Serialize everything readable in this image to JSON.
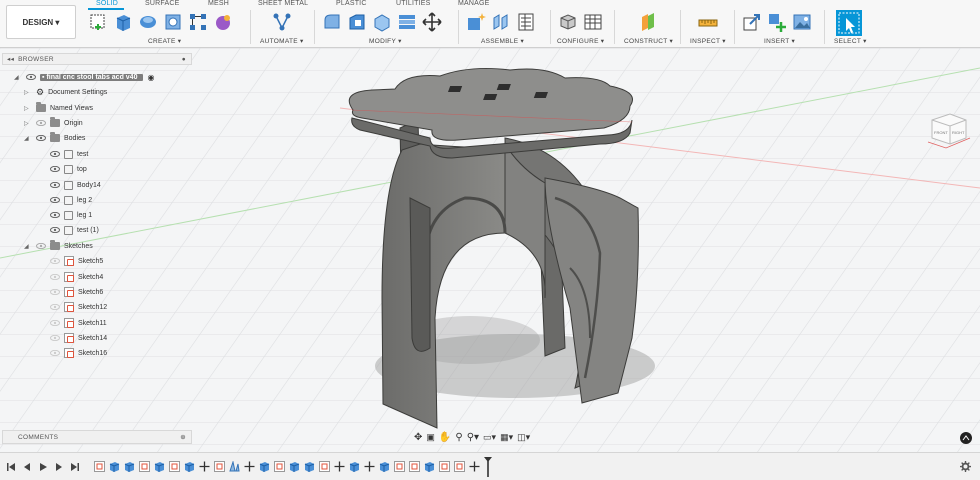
{
  "design_label": "DESIGN ▾",
  "tabs": [
    "SOLID",
    "SURFACE",
    "MESH",
    "SHEET METAL",
    "PLASTIC",
    "UTILITIES",
    "MANAGE"
  ],
  "groups": {
    "create": "CREATE ▾",
    "automate": "AUTOMATE ▾",
    "modify": "MODIFY ▾",
    "assemble": "ASSEMBLE ▾",
    "configure": "CONFIGURE ▾",
    "construct": "CONSTRUCT ▾",
    "inspect": "INSPECT ▾",
    "insert": "INSERT ▾",
    "select": "SELECT ▾"
  },
  "browser": {
    "title": "BROWSER",
    "root": "final cnc stool tabs acd v40",
    "items": {
      "document_settings": "Document Settings",
      "named_views": "Named Views",
      "origin": "Origin",
      "bodies": "Bodies",
      "sketches": "Sketches"
    },
    "bodies": [
      "test",
      "top",
      "Body14",
      "leg 2",
      "leg 1",
      "test (1)"
    ],
    "sketches": [
      "Sketch5",
      "Sketch4",
      "Sketch6",
      "Sketch12",
      "Sketch11",
      "Sketch14",
      "Sketch16"
    ]
  },
  "comments_label": "COMMENTS",
  "viewcube": {
    "front": "FRONT",
    "right": "RIGHT"
  },
  "colors": {
    "accent": "#0696d7",
    "body": "#7a7a78",
    "body_dark": "#5e5e5c",
    "grid": "#dcdde0"
  }
}
